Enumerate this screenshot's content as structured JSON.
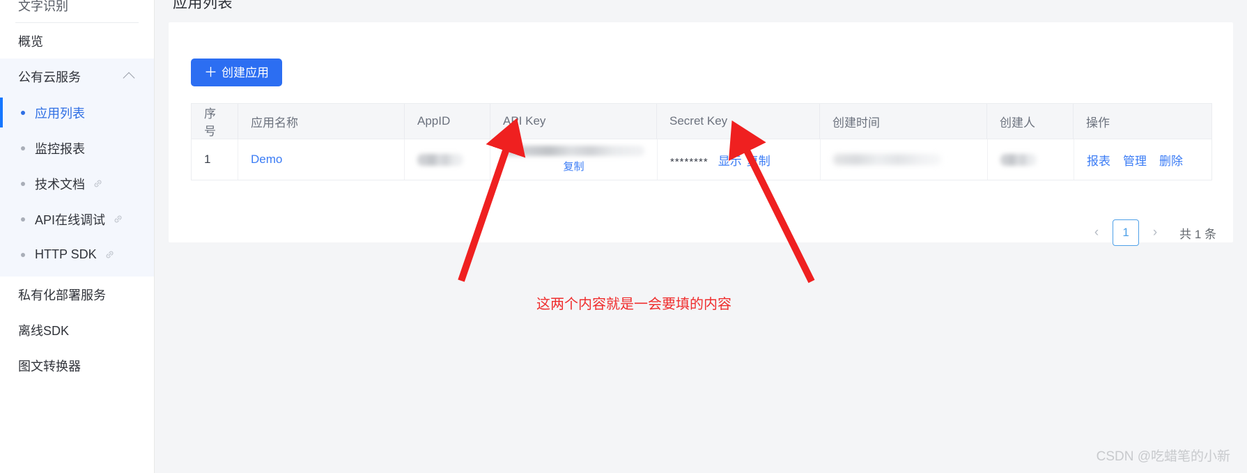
{
  "sidebar": {
    "brand": "文字识别",
    "overview": {
      "label": "概览"
    },
    "group": {
      "label": "公有云服务",
      "chevron": "chevron-up-icon"
    },
    "subitems": [
      {
        "label": "应用列表",
        "active": true,
        "external": false
      },
      {
        "label": "监控报表",
        "active": false,
        "external": false
      },
      {
        "label": "技术文档",
        "active": false,
        "external": true
      },
      {
        "label": "API在线调试",
        "active": false,
        "external": true
      },
      {
        "label": "HTTP SDK",
        "active": false,
        "external": true
      }
    ],
    "items": [
      {
        "label": "私有化部署服务"
      },
      {
        "label": "离线SDK"
      },
      {
        "label": "图文转换器"
      }
    ]
  },
  "main": {
    "title": "应用列表",
    "create_button": {
      "plus": "＋",
      "label": "创建应用"
    }
  },
  "table": {
    "columns": [
      "序号",
      "应用名称",
      "AppID",
      "API Key",
      "Secret Key",
      "创建时间",
      "创建人",
      "操作"
    ],
    "rows": [
      {
        "index": "1",
        "name": "Demo",
        "appid": "",
        "apikey": "",
        "apikey_copy": "复制",
        "secret_masked": "********",
        "secret_show": "显示",
        "secret_copy": "复制",
        "created_at": "",
        "creator": "",
        "actions": [
          "报表",
          "管理",
          "删除"
        ]
      }
    ]
  },
  "pagination": {
    "prev": "‹",
    "current_page": "1",
    "next": "›",
    "total_label": "共 1 条"
  },
  "annotation": {
    "text": "这两个内容就是一会要填的内容",
    "color": "#ef2d2d"
  },
  "watermark": "CSDN @吃蜡笔的小新",
  "colors": {
    "primary": "#2c6ef2",
    "link": "#3b7cf5",
    "sidebar_active_bg": "#f4f7fd",
    "page_bg": "#f4f5f7",
    "annotation_red": "#ef2d2d"
  }
}
